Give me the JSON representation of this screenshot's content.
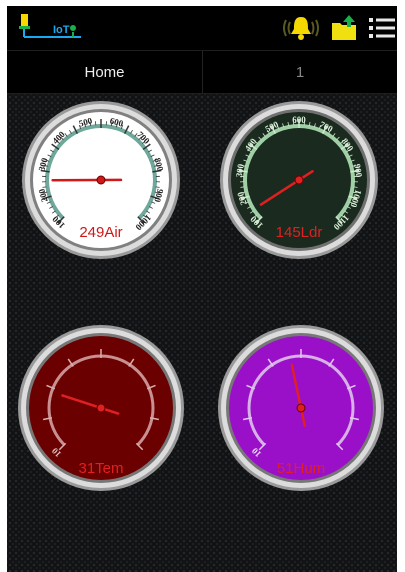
{
  "app": {
    "logo_text": "IoT",
    "colors": {
      "accent": "#1aa8f0",
      "logo_green": "#19b04b",
      "bell": "#f5d800",
      "folder": "#f0e010"
    }
  },
  "toolbar": {
    "icons": [
      "iot-logo-icon",
      "bell-ringing-icon",
      "folder-upload-icon",
      "list-menu-icon"
    ]
  },
  "tabs": [
    {
      "label": "Home"
    },
    {
      "label": "1"
    }
  ],
  "gauges": [
    {
      "label": "249Air",
      "value": 249,
      "unit": "Air",
      "min": 100,
      "max": 1000,
      "ticks": [
        "100",
        "200",
        "300",
        "400",
        "500",
        "600",
        "700",
        "800",
        "900",
        "1000"
      ],
      "style": "white",
      "face_color": "#ffffff",
      "text_color": "#d01818"
    },
    {
      "label": "145Ldr",
      "value": 145,
      "unit": "Ldr",
      "min": 100,
      "max": 1100,
      "ticks": [
        "100",
        "200",
        "300",
        "400",
        "500",
        "600",
        "700",
        "800",
        "900",
        "1000",
        "1100"
      ],
      "style": "dark-green",
      "face_color": "#1b2a1f",
      "text_color": "#e02020"
    },
    {
      "label": "31Tem",
      "value": 31,
      "unit": "Tem",
      "min": 10,
      "max": 100,
      "ticks": [
        "10"
      ],
      "style": "maroon",
      "face_color": "#6a0000",
      "text_color": "#e02020"
    },
    {
      "label": "51Hum",
      "value": 51,
      "unit": "Hum",
      "min": 10,
      "max": 100,
      "ticks": [
        "10"
      ],
      "style": "purple",
      "face_color": "#9a10c8",
      "text_color": "#e02020"
    }
  ]
}
